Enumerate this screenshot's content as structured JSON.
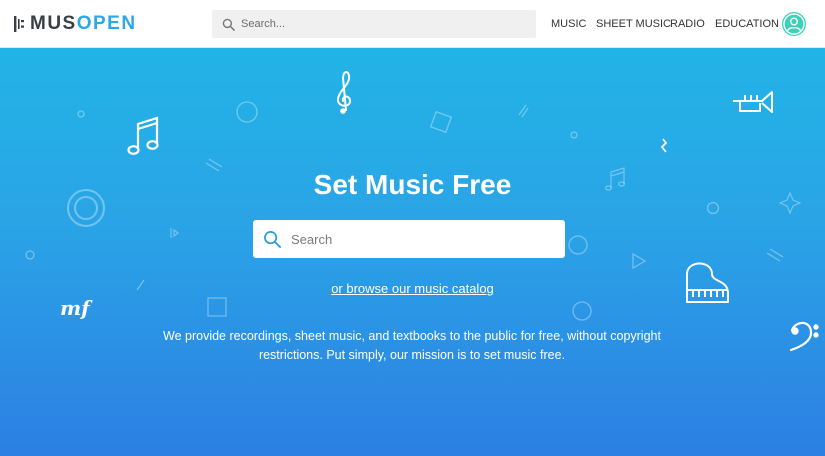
{
  "header": {
    "logo": {
      "part1": "MUS",
      "part2": "OPEN"
    },
    "search": {
      "placeholder": "Search..."
    },
    "nav": [
      {
        "label": "MUSIC"
      },
      {
        "label": "SHEET MUSIC"
      },
      {
        "label": "RADIO"
      },
      {
        "label": "EDUCATION"
      }
    ]
  },
  "hero": {
    "title": "Set Music Free",
    "search": {
      "placeholder": "Search"
    },
    "browse_link": "or browse our music catalog",
    "description": "We provide recordings, sheet music, and textbooks to the public for free, without copyright restrictions. Put simply, our mission is to set music free.",
    "dynamic_mark": "mf"
  },
  "icons": {
    "logo": "musopen-logo-icon",
    "search": "search-icon",
    "avatar": "user-avatar-icon",
    "treble_clef": "treble-clef-icon",
    "bass_clef": "bass-clef-icon",
    "eighth_notes": "music-notes-icon",
    "trumpet": "trumpet-icon",
    "piano": "piano-icon"
  },
  "colors": {
    "brand_blue": "#2aa8e8",
    "logo_dark": "#3a3f45",
    "avatar": "#3ed1b8",
    "hero_top": "#22b4e6",
    "hero_bottom": "#2c7fe3"
  }
}
